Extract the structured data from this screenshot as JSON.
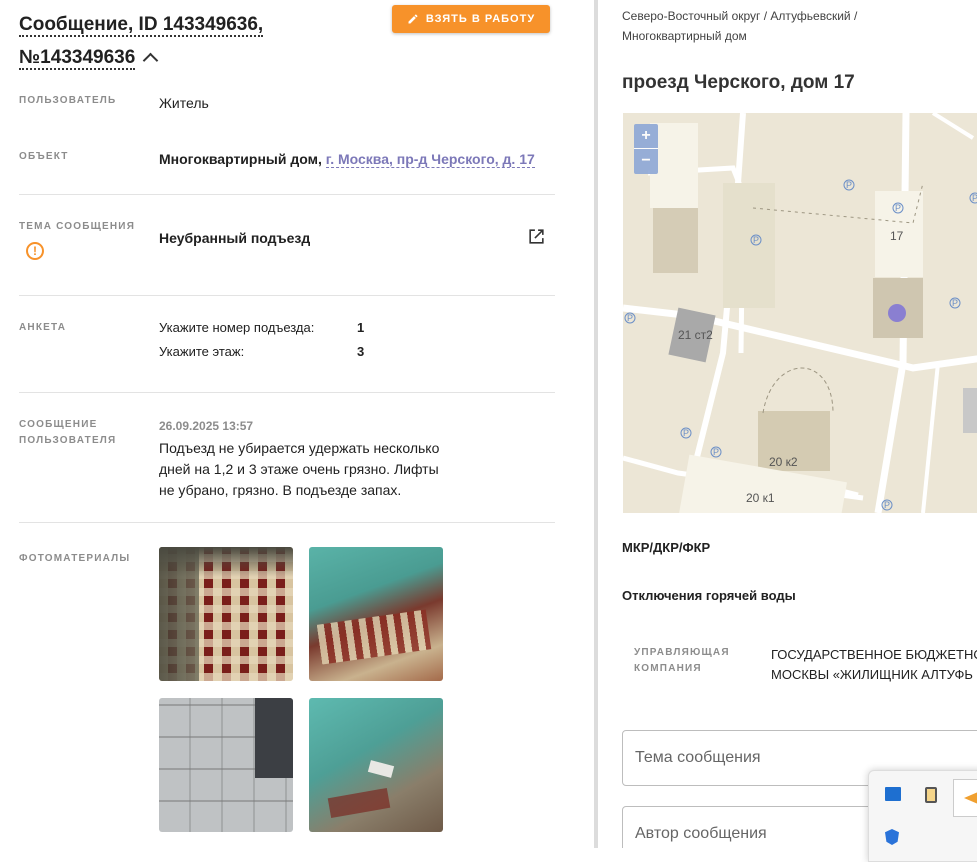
{
  "header": {
    "title": "Сообщение, ID 143349636, №143349636",
    "take_button": "ВЗЯТЬ В РАБОТУ"
  },
  "fields": {
    "user_label": "ПОЛЬЗОВАТЕЛЬ",
    "user_value": "Житель",
    "object_label": "ОБЪЕКТ",
    "object_type": "Многоквартирный дом,",
    "object_address": "г. Москва, пр-д Черского, д. 17",
    "topic_label": "ТЕМА СООБЩЕНИЯ",
    "topic_value": "Неубранный подъезд",
    "survey_label": "АНКЕТА",
    "survey": [
      {
        "q": "Укажите номер подъезда:",
        "a": "1"
      },
      {
        "q": "Укажите этаж:",
        "a": "3"
      }
    ],
    "message_label_1": "СООБЩЕНИЕ",
    "message_label_2": "ПОЛЬЗОВАТЕЛЯ",
    "message_date": "26.09.2025 13:57",
    "message_line_1": "Подъезд не убирается удержать несколько",
    "message_line_2": "дней на 1,2 и 3 этаже очень грязно. Лифты",
    "message_line_3": "не убрано, грязно. В подъезде запах.",
    "photos_label": "ФОТОМАТЕРИАЛЫ"
  },
  "right": {
    "breadcrumb_1": "Северо-Восточный округ / Алтуфьевский /",
    "breadcrumb_2": "Многоквартирный дом",
    "address": "проезд Черского, дом 17",
    "map": {
      "zoom_in": "+",
      "zoom_out": "−",
      "labels": {
        "b17": "17",
        "b21": "21 ст2",
        "b20k2": "20 к2",
        "b20k1": "20 к1",
        "parking": "P"
      }
    },
    "program": "МКР/ДКР/ФКР",
    "hot_water": "Отключения горячей воды",
    "mc_label_1": "УПРАВЛЯЮЩАЯ",
    "mc_label_2": "КОМПАНИЯ",
    "mc_value_1": "ГОСУДАРСТВЕННОЕ БЮДЖЕТНО",
    "mc_value_2": "МОСКВЫ «ЖИЛИЩНИК АЛТУФЬ",
    "field_topic": "Тема сообщения",
    "field_author": "Автор сообщения"
  },
  "colors": {
    "accent": "#f7922a",
    "link": "#7c78b8",
    "map_marker": "#8a7fd1"
  }
}
